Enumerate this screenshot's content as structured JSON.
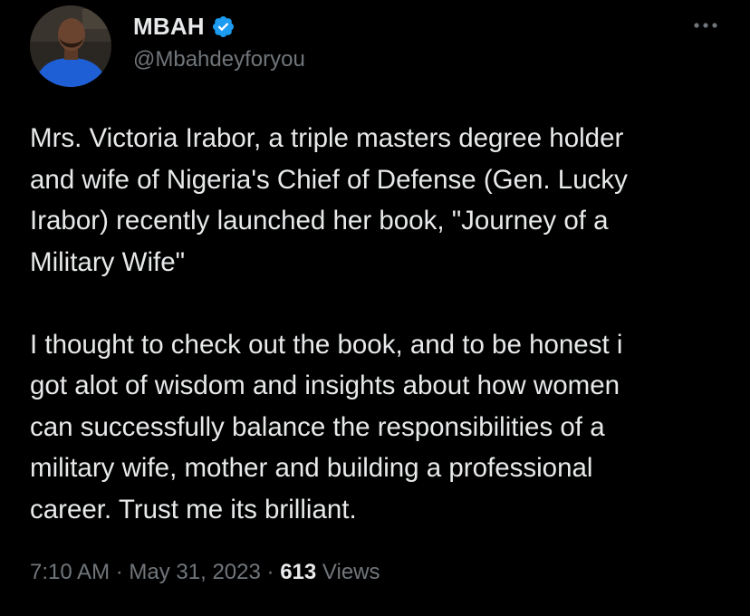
{
  "author": {
    "display_name": "MBAH",
    "handle": "@Mbahdeyforyou",
    "verified": true,
    "avatar_icon": "profile-photo-man-blue-shirt"
  },
  "tweet": {
    "paragraph_1": "Mrs. Victoria Irabor, a triple masters degree holder\nand wife of Nigeria's Chief of Defense (Gen. Lucky\nIrabor) recently launched her book, \"Journey of a\nMilitary Wife\"",
    "paragraph_2": "I thought to check out the book, and to be honest i\ngot alot of wisdom and insights about how women\ncan successfully balance the responsibilities of a\nmilitary wife, mother and building a professional\ncareer. Trust me its brilliant."
  },
  "meta": {
    "time": "7:10 AM",
    "separator": "·",
    "date": "May 31, 2023",
    "views_count": "613",
    "views_label": "Views"
  },
  "colors": {
    "background": "#000000",
    "text_primary": "#e7e9ea",
    "text_secondary": "#71767b",
    "verified_badge": "#1d9bf0"
  },
  "icons": {
    "more": "more-horizontal-icon",
    "verified": "verified-badge-icon"
  }
}
